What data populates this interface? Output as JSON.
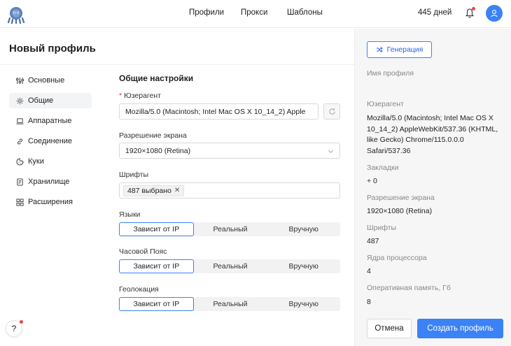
{
  "nav": {
    "items": [
      "Профили",
      "Прокси",
      "Шаблоны"
    ],
    "days": "445 дней"
  },
  "page": {
    "title": "Новый профиль"
  },
  "sidebar": {
    "items": [
      {
        "label": "Основные",
        "icon": "sliders-icon"
      },
      {
        "label": "Общие",
        "icon": "gear-icon"
      },
      {
        "label": "Аппаратные",
        "icon": "laptop-icon"
      },
      {
        "label": "Соединение",
        "icon": "link-icon"
      },
      {
        "label": "Куки",
        "icon": "cookie-icon"
      },
      {
        "label": "Хранилище",
        "icon": "storage-icon"
      },
      {
        "label": "Расширения",
        "icon": "puzzle-icon"
      }
    ],
    "active": "Общие"
  },
  "form": {
    "section_title": "Общие настройки",
    "useragent_label": "Юзерагент",
    "useragent_value": "Mozilla/5.0 (Macintosh; Intel Mac OS X 10_14_2) Apple",
    "resolution_label": "Разрешение экрана",
    "resolution_value": "1920×1080 (Retina)",
    "fonts_label": "Шрифты",
    "fonts_tag": "487 выбрано",
    "languages_label": "Языки",
    "timezone_label": "Часовой Пояс",
    "geolocation_label": "Геолокация",
    "options": [
      "Зависит от IP",
      "Реальный",
      "Вручную"
    ],
    "selected_option": "Зависит от IP"
  },
  "summary": {
    "generate_label": "Генерация",
    "profile_name_label": "Имя профиля",
    "useragent_label": "Юзерагент",
    "useragent_value": "Mozilla/5.0 (Macintosh; Intel Mac OS X 10_14_2) AppleWebKit/537.36 (KHTML, like Gecko) Chrome/115.0.0.0 Safari/537.36",
    "bookmarks_label": "Закладки",
    "bookmarks_value": "+ 0",
    "resolution_label": "Разрешение экрана",
    "resolution_value": "1920×1080 (Retina)",
    "fonts_label": "Шрифты",
    "fonts_value": "487",
    "cpu_label": "Ядра процессора",
    "cpu_value": "4",
    "ram_label": "Оперативная память, Гб",
    "ram_value": "8",
    "cancel_label": "Отмена",
    "create_label": "Создать профиль"
  },
  "help": {
    "label": "?"
  },
  "colors": {
    "accent": "#3b82f6",
    "danger": "#ef4444",
    "panel": "#f6f6f7"
  }
}
